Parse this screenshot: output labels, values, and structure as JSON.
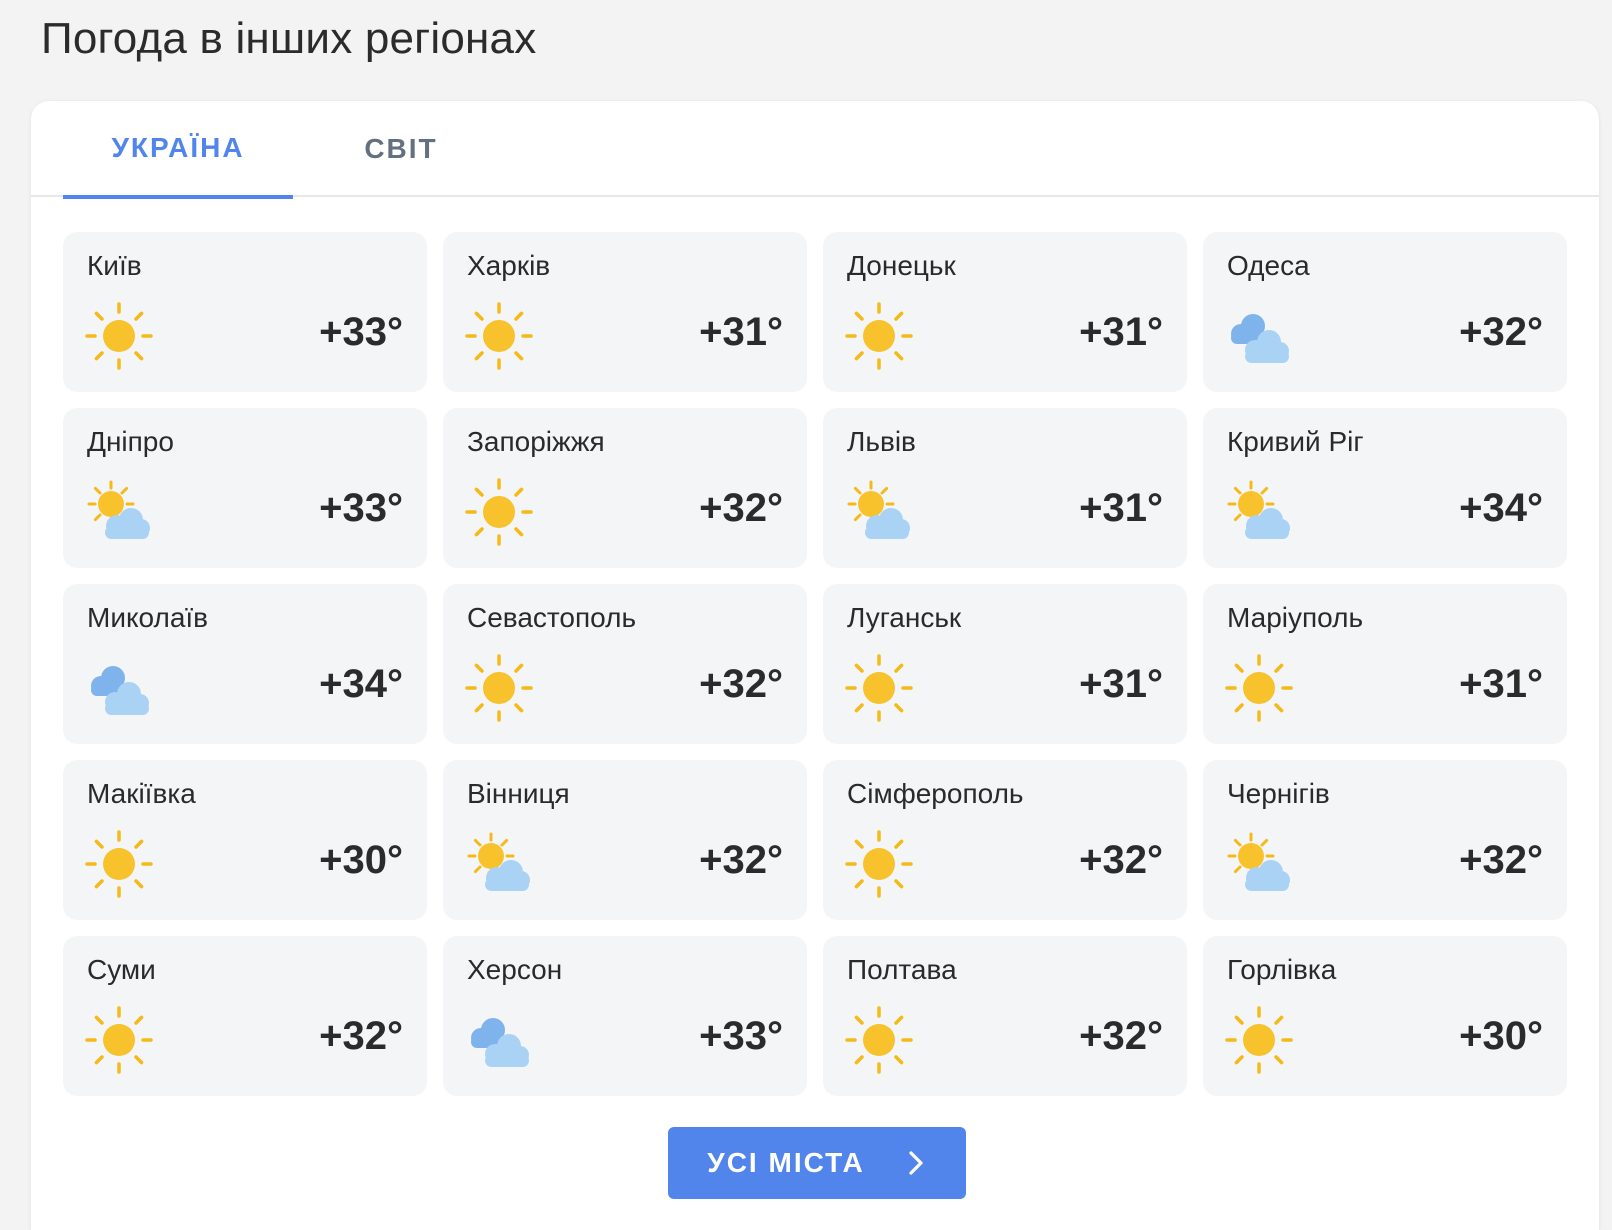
{
  "page_title": "Погода в інших регіонах",
  "tabs": [
    {
      "label": "УКРАЇНА",
      "active": true
    },
    {
      "label": "СВІТ",
      "active": false
    }
  ],
  "accent_color": "#5285ec",
  "cities": [
    {
      "name": "Київ",
      "temp": "+33°",
      "icon": "sunny"
    },
    {
      "name": "Харків",
      "temp": "+31°",
      "icon": "sunny"
    },
    {
      "name": "Донецьк",
      "temp": "+31°",
      "icon": "sunny"
    },
    {
      "name": "Одеса",
      "temp": "+32°",
      "icon": "cloudy"
    },
    {
      "name": "Дніпро",
      "temp": "+33°",
      "icon": "partly-cloudy"
    },
    {
      "name": "Запоріжжя",
      "temp": "+32°",
      "icon": "sunny"
    },
    {
      "name": "Львів",
      "temp": "+31°",
      "icon": "partly-cloudy"
    },
    {
      "name": "Кривий Ріг",
      "temp": "+34°",
      "icon": "partly-cloudy"
    },
    {
      "name": "Миколаїв",
      "temp": "+34°",
      "icon": "cloudy"
    },
    {
      "name": "Севастополь",
      "temp": "+32°",
      "icon": "sunny"
    },
    {
      "name": "Луганськ",
      "temp": "+31°",
      "icon": "sunny"
    },
    {
      "name": "Маріуполь",
      "temp": "+31°",
      "icon": "sunny"
    },
    {
      "name": "Макіївка",
      "temp": "+30°",
      "icon": "sunny"
    },
    {
      "name": "Вінниця",
      "temp": "+32°",
      "icon": "partly-cloudy"
    },
    {
      "name": "Сімферополь",
      "temp": "+32°",
      "icon": "sunny"
    },
    {
      "name": "Чернігів",
      "temp": "+32°",
      "icon": "partly-cloudy"
    },
    {
      "name": "Суми",
      "temp": "+32°",
      "icon": "sunny"
    },
    {
      "name": "Херсон",
      "temp": "+33°",
      "icon": "cloudy"
    },
    {
      "name": "Полтава",
      "temp": "+32°",
      "icon": "sunny"
    },
    {
      "name": "Горлівка",
      "temp": "+30°",
      "icon": "sunny"
    }
  ],
  "all_cities_button": {
    "label": "УСІ МІСТА",
    "icon": "chevron-right-icon"
  }
}
